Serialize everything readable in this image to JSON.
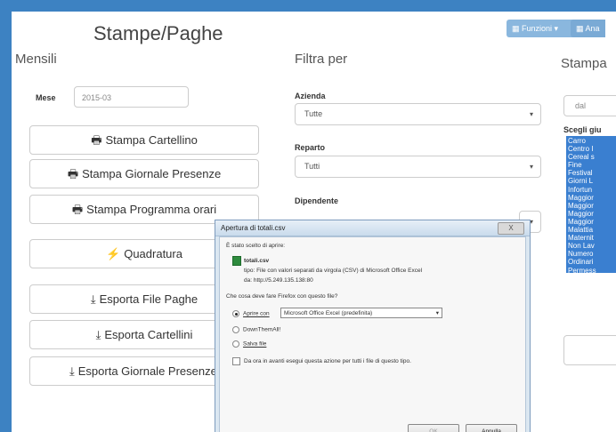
{
  "topbar": {
    "funzioni": "Funzioni",
    "funzioni_icon": "grid-icon",
    "ana": "Ana"
  },
  "page_title": "Stampe/Paghe",
  "mensili": {
    "heading": "Mensili",
    "mese_label": "Mese",
    "mese_value": "2015-03",
    "buttons": [
      {
        "label": "Stampa Cartellino",
        "icon": "print-icon",
        "glyph": "🖶"
      },
      {
        "label": "Stampa Giornale Presenze",
        "icon": "print-icon",
        "glyph": "🖶"
      },
      {
        "label": "Stampa Programma orari",
        "icon": "print-icon",
        "glyph": "🖶"
      },
      {
        "label": "Quadratura",
        "icon": "bolt-icon",
        "glyph": "⚡"
      },
      {
        "label": "Esporta File Paghe",
        "icon": "download-icon",
        "glyph": "⤓"
      },
      {
        "label": "Esporta Cartellini",
        "icon": "download-icon",
        "glyph": "⤓"
      },
      {
        "label": "Esporta Giornale Presenze",
        "icon": "download-icon",
        "glyph": "⤓"
      }
    ]
  },
  "filtra": {
    "heading": "Filtra per",
    "azienda_label": "Azienda",
    "azienda_value": "Tutte",
    "reparto_label": "Reparto",
    "reparto_value": "Tutti",
    "dipendente_label": "Dipendente",
    "arrow": "▾"
  },
  "stampa_right": {
    "heading": "Stampa",
    "dal": "dal",
    "scegli_label": "Scegli giu",
    "list": [
      "Carro",
      "Centro I",
      "Cereal s",
      "Fine",
      "Festival",
      "Giorni L",
      "Infortun",
      "Maggior",
      "Maggior",
      "Maggior",
      "Maggior",
      "Malattia",
      "Maternit",
      "Non Lav",
      "Numero",
      "Ordinari",
      "Permess"
    ]
  },
  "dialog": {
    "title": "Apertura di totali.csv",
    "close": "X",
    "intro": "È stato scelto di aprire:",
    "file_icon": "csv-file-icon",
    "filename": "totali.csv",
    "tipo": "tipo: File con valori separati da virgola (CSV) di Microsoft Office Excel",
    "da": "da: http://5.249.135.138:80",
    "question": "Che cosa deve fare Firefox con questo file?",
    "option_open_label": "Aprire con",
    "option_open_app": "Microsoft Office Excel (predefinita)",
    "option_downthemall": "DownThemAll!",
    "option_save": "Salva file",
    "checkbox_label": "Da ora in avanti esegui questa azione per tutti i file di questo tipo.",
    "ok": "OK",
    "cancel": "Annulla"
  }
}
